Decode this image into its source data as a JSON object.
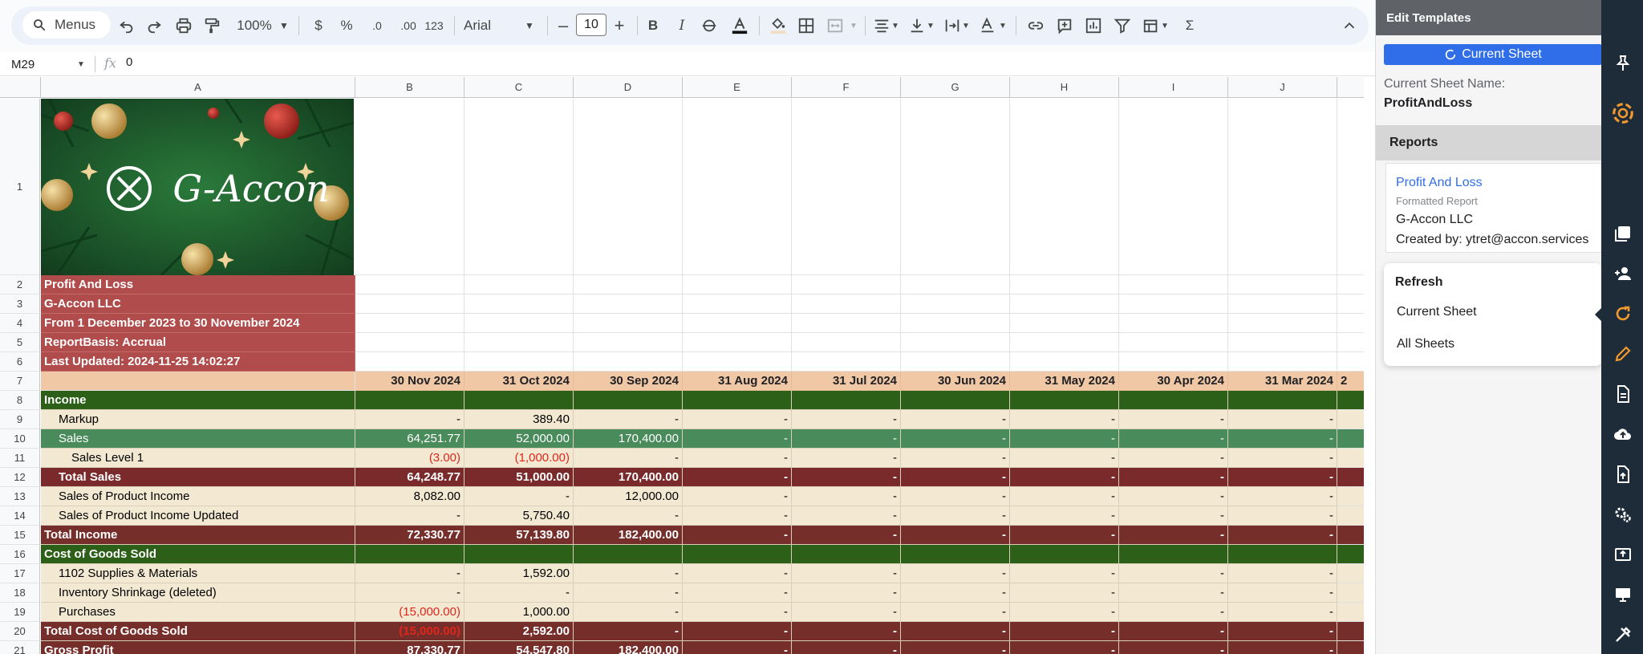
{
  "toolbar": {
    "menus_label": "Menus",
    "zoom": "100%",
    "currency": "$",
    "percent": "%",
    "decrease_decimals": ".0",
    "increase_decimals": ".00",
    "number_format": "123",
    "font": "Arial",
    "font_size": "10",
    "bold": "B",
    "italic": "I",
    "sum": "Σ"
  },
  "formula_bar": {
    "cell_ref": "M29",
    "fx": "fx",
    "value": "0"
  },
  "grid": {
    "column_headers": [
      "A",
      "B",
      "C",
      "D",
      "E",
      "F",
      "G",
      "H",
      "I",
      "J"
    ],
    "row_numbers": [
      "1",
      "2",
      "3",
      "4",
      "5",
      "6",
      "7",
      "8",
      "9",
      "10",
      "11",
      "12",
      "13",
      "14",
      "15",
      "16",
      "17",
      "18",
      "19",
      "20",
      "21"
    ],
    "banner_text": "G-Accon",
    "report_title": "Profit And Loss",
    "company": "G-Accon LLC",
    "period": "From 1 December 2023 to 30 November 2024",
    "basis": "ReportBasis: Accrual",
    "updated": "Last Updated: 2024-11-25 14:02:27",
    "date_headers": [
      "30 Nov 2024",
      "31 Oct 2024",
      "30 Sep 2024",
      "31 Aug 2024",
      "31 Jul 2024",
      "30 Jun 2024",
      "31 May 2024",
      "30 Apr 2024",
      "31 Mar 2024",
      "2"
    ],
    "rows": [
      {
        "label": "Income",
        "style": "section",
        "values": []
      },
      {
        "label": "Markup",
        "style": "item",
        "values": [
          "-",
          "389.40",
          "-",
          "-",
          "-",
          "-",
          "-",
          "-",
          "-"
        ]
      },
      {
        "label": "Sales",
        "style": "sub",
        "values": [
          "64,251.77",
          "52,000.00",
          "170,400.00",
          "-",
          "-",
          "-",
          "-",
          "-",
          "-"
        ]
      },
      {
        "label": "Sales Level 1",
        "style": "item2",
        "values": [
          "(3.00)",
          "(1,000.00)",
          "-",
          "-",
          "-",
          "-",
          "-",
          "-",
          "-"
        ]
      },
      {
        "label": "Total Sales",
        "style": "total_in",
        "values": [
          "64,248.77",
          "51,000.00",
          "170,400.00",
          "-",
          "-",
          "-",
          "-",
          "-",
          "-"
        ]
      },
      {
        "label": "Sales of Product Income",
        "style": "item",
        "values": [
          "8,082.00",
          "-",
          "12,000.00",
          "-",
          "-",
          "-",
          "-",
          "-",
          "-"
        ]
      },
      {
        "label": "Sales of Product Income Updated",
        "style": "item",
        "values": [
          "-",
          "5,750.40",
          "-",
          "-",
          "-",
          "-",
          "-",
          "-",
          "-"
        ]
      },
      {
        "label": "Total Income",
        "style": "total",
        "values": [
          "72,330.77",
          "57,139.80",
          "182,400.00",
          "-",
          "-",
          "-",
          "-",
          "-",
          "-"
        ]
      },
      {
        "label": "Cost of Goods Sold",
        "style": "section",
        "values": []
      },
      {
        "label": "1102 Supplies & Materials",
        "style": "item",
        "values": [
          "-",
          "1,592.00",
          "-",
          "-",
          "-",
          "-",
          "-",
          "-",
          "-"
        ]
      },
      {
        "label": "Inventory Shrinkage (deleted)",
        "style": "item",
        "values": [
          "-",
          "-",
          "-",
          "-",
          "-",
          "-",
          "-",
          "-",
          "-"
        ]
      },
      {
        "label": "Purchases",
        "style": "item",
        "values": [
          "(15,000.00)",
          "1,000.00",
          "-",
          "-",
          "-",
          "-",
          "-",
          "-",
          "-"
        ]
      },
      {
        "label": "Total Cost of Goods Sold",
        "style": "total",
        "values": [
          "(15,000.00)",
          "2,592.00",
          "-",
          "-",
          "-",
          "-",
          "-",
          "-",
          "-"
        ]
      },
      {
        "label": "Gross Profit",
        "style": "total",
        "values": [
          "87,330.77",
          "54,547.80",
          "182,400.00",
          "-",
          "-",
          "-",
          "-",
          "-",
          "-"
        ]
      }
    ]
  },
  "panel": {
    "title": "Edit Templates",
    "close": "✕",
    "current_sheet_button": "Current Sheet",
    "sheet_name_label": "Current Sheet Name:",
    "sheet_name": "ProfitAndLoss",
    "reports_heading": "Reports",
    "report": {
      "title": "Profit And Loss",
      "type": "Formatted Report",
      "company": "G-Accon LLC",
      "created_by": "Created by: ytret@accon.services"
    },
    "refresh": {
      "title": "Refresh",
      "items": [
        "Current Sheet",
        "All Sheets"
      ]
    }
  },
  "colors": {
    "header_red": "#b14c4c",
    "date_row": "#f0c8a6",
    "section_green": "#2c5f17",
    "sub_green": "#4a8b5c",
    "item_beige": "#f3e9d2",
    "total_maroon": "#7a2a2a",
    "total_income_maroon": "#762e2b",
    "accent_blue": "#2f6ee8",
    "rail_dark": "#1e2b38"
  },
  "rail_icons": [
    "pin-icon",
    "g-accon-logo-icon",
    "report-library-icon",
    "add-user-icon",
    "refresh-icon",
    "edit-pencil-icon",
    "document-icon",
    "cloud-upload-icon",
    "file-upload-icon",
    "settings-gears-icon",
    "export-icon",
    "monitor-icon",
    "tools-icon"
  ]
}
